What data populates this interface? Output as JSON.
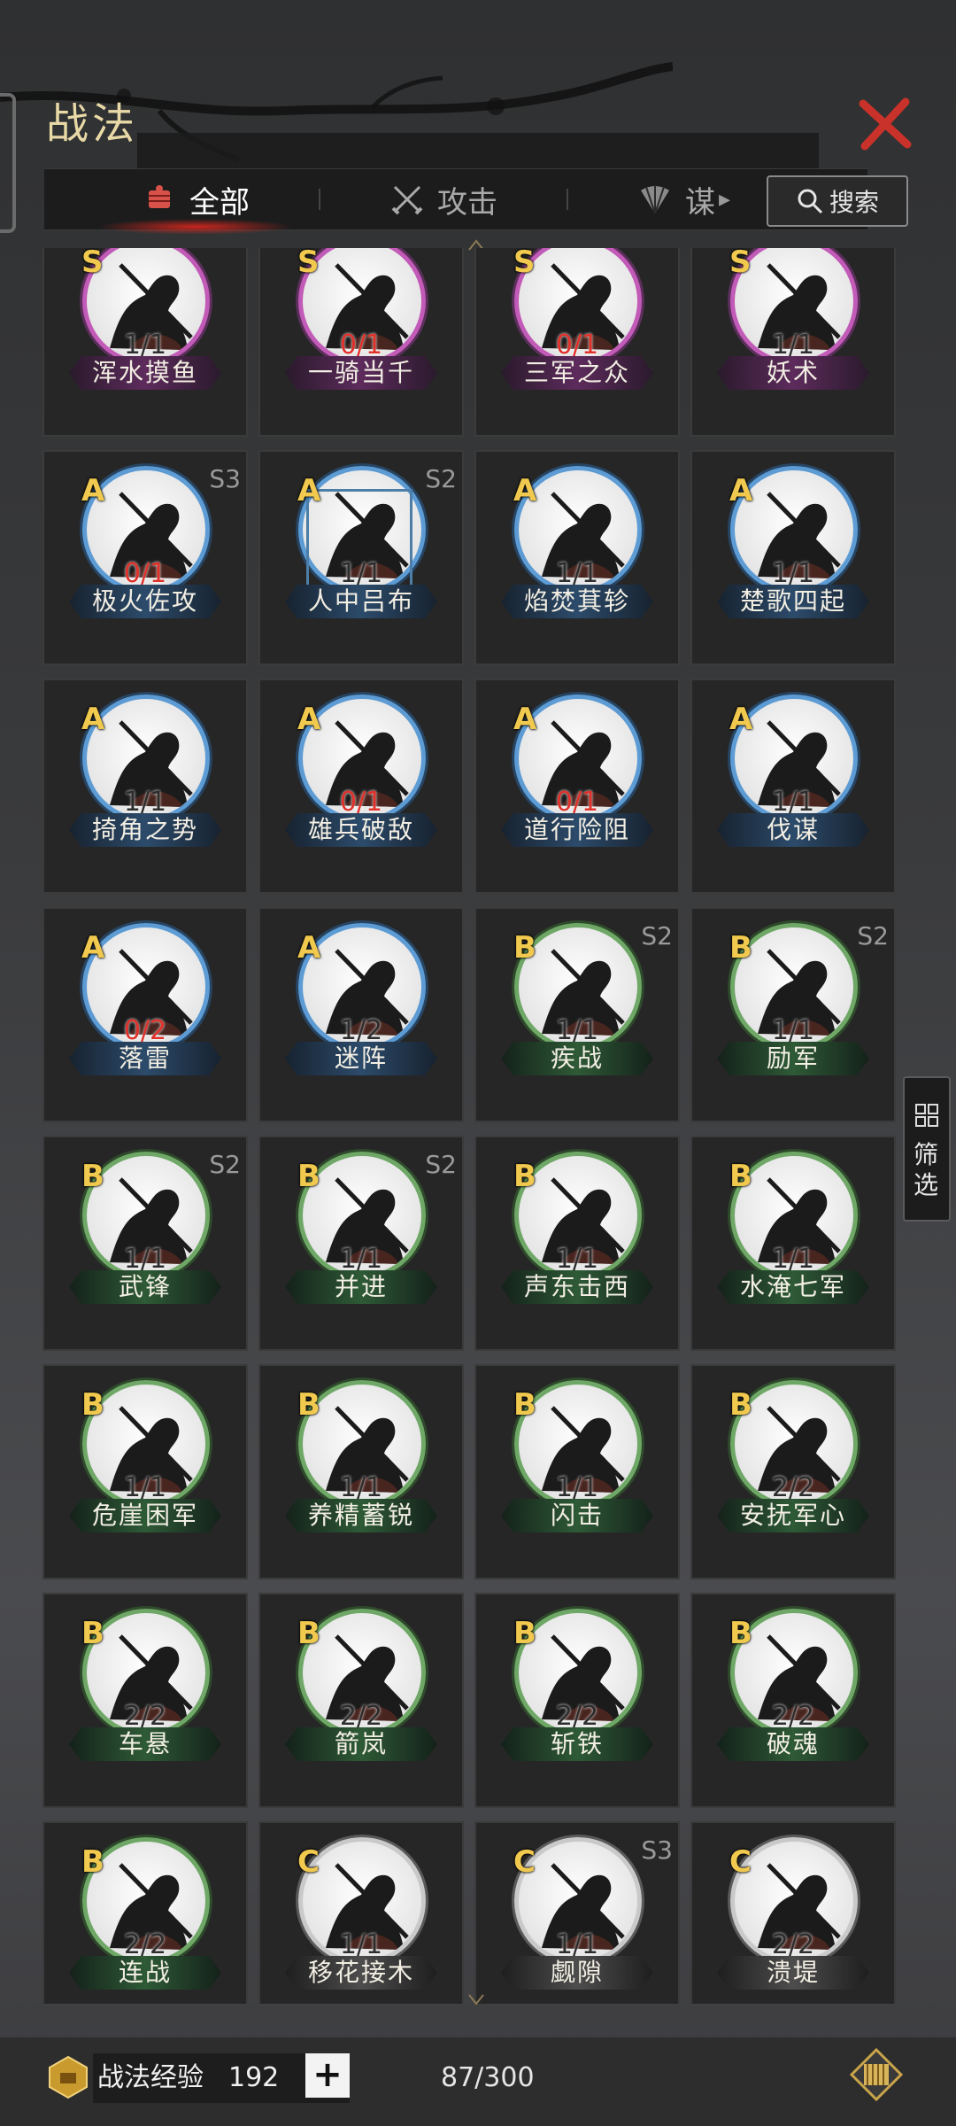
{
  "header": {
    "title": "战法"
  },
  "tabs": [
    {
      "label": "全部",
      "active": true
    },
    {
      "label": "攻击"
    },
    {
      "label": "谋"
    }
  ],
  "search": {
    "label": "搜索"
  },
  "filter": {
    "label": "筛\n选"
  },
  "colors": {
    "S": "#c25ab8",
    "A": "#5c9bd4",
    "B": "#6ea766",
    "C": "#c9c9c9",
    "count_red": "#e0312a",
    "grade": "#f0c94e"
  },
  "cards": [
    {
      "grade": "S",
      "season": "",
      "count": "1/1",
      "red": false,
      "name": "浑水摸鱼"
    },
    {
      "grade": "S",
      "season": "",
      "count": "0/1",
      "red": true,
      "name": "一骑当千"
    },
    {
      "grade": "S",
      "season": "",
      "count": "0/1",
      "red": true,
      "name": "三军之众"
    },
    {
      "grade": "S",
      "season": "",
      "count": "1/1",
      "red": false,
      "name": "妖术"
    },
    {
      "grade": "A",
      "season": "S3",
      "count": "0/1",
      "red": true,
      "name": "极火佐攻"
    },
    {
      "grade": "A",
      "season": "S2",
      "count": "1/1",
      "red": false,
      "name": "人中吕布",
      "selected": true
    },
    {
      "grade": "A",
      "season": "",
      "count": "1/1",
      "red": false,
      "name": "焰焚萁轸"
    },
    {
      "grade": "A",
      "season": "",
      "count": "1/1",
      "red": false,
      "name": "楚歌四起"
    },
    {
      "grade": "A",
      "season": "",
      "count": "1/1",
      "red": false,
      "name": "掎角之势"
    },
    {
      "grade": "A",
      "season": "",
      "count": "0/1",
      "red": true,
      "name": "雄兵破敌"
    },
    {
      "grade": "A",
      "season": "",
      "count": "0/1",
      "red": true,
      "name": "道行险阻"
    },
    {
      "grade": "A",
      "season": "",
      "count": "1/1",
      "red": false,
      "name": "伐谋"
    },
    {
      "grade": "A",
      "season": "",
      "count": "0/2",
      "red": true,
      "name": "落雷"
    },
    {
      "grade": "A",
      "season": "",
      "count": "1/2",
      "red": false,
      "name": "迷阵"
    },
    {
      "grade": "B",
      "season": "S2",
      "count": "1/1",
      "red": false,
      "name": "疾战"
    },
    {
      "grade": "B",
      "season": "S2",
      "count": "1/1",
      "red": false,
      "name": "励军"
    },
    {
      "grade": "B",
      "season": "S2",
      "count": "1/1",
      "red": false,
      "name": "武锋"
    },
    {
      "grade": "B",
      "season": "S2",
      "count": "1/1",
      "red": false,
      "name": "并进"
    },
    {
      "grade": "B",
      "season": "",
      "count": "1/1",
      "red": false,
      "name": "声东击西"
    },
    {
      "grade": "B",
      "season": "",
      "count": "1/1",
      "red": false,
      "name": "水淹七军"
    },
    {
      "grade": "B",
      "season": "",
      "count": "1/1",
      "red": false,
      "name": "危崖困军"
    },
    {
      "grade": "B",
      "season": "",
      "count": "1/1",
      "red": false,
      "name": "养精蓄锐"
    },
    {
      "grade": "B",
      "season": "",
      "count": "1/1",
      "red": false,
      "name": "闪击"
    },
    {
      "grade": "B",
      "season": "",
      "count": "2/2",
      "red": false,
      "name": "安抚军心"
    },
    {
      "grade": "B",
      "season": "",
      "count": "2/2",
      "red": false,
      "name": "车悬"
    },
    {
      "grade": "B",
      "season": "",
      "count": "2/2",
      "red": false,
      "name": "箭岚"
    },
    {
      "grade": "B",
      "season": "",
      "count": "2/2",
      "red": false,
      "name": "斩铁"
    },
    {
      "grade": "B",
      "season": "",
      "count": "2/2",
      "red": false,
      "name": "破魂"
    },
    {
      "grade": "B",
      "season": "",
      "count": "2/2",
      "red": false,
      "name": "连战"
    },
    {
      "grade": "C",
      "season": "",
      "count": "1/1",
      "red": false,
      "name": "移花接木"
    },
    {
      "grade": "C",
      "season": "S3",
      "count": "1/1",
      "red": false,
      "name": "觑隙"
    },
    {
      "grade": "C",
      "season": "",
      "count": "2/2",
      "red": false,
      "name": "溃堤"
    }
  ],
  "footer": {
    "exp_label": "战法经验",
    "exp_value": "192",
    "plus_label": "+",
    "capacity": "87/300"
  }
}
